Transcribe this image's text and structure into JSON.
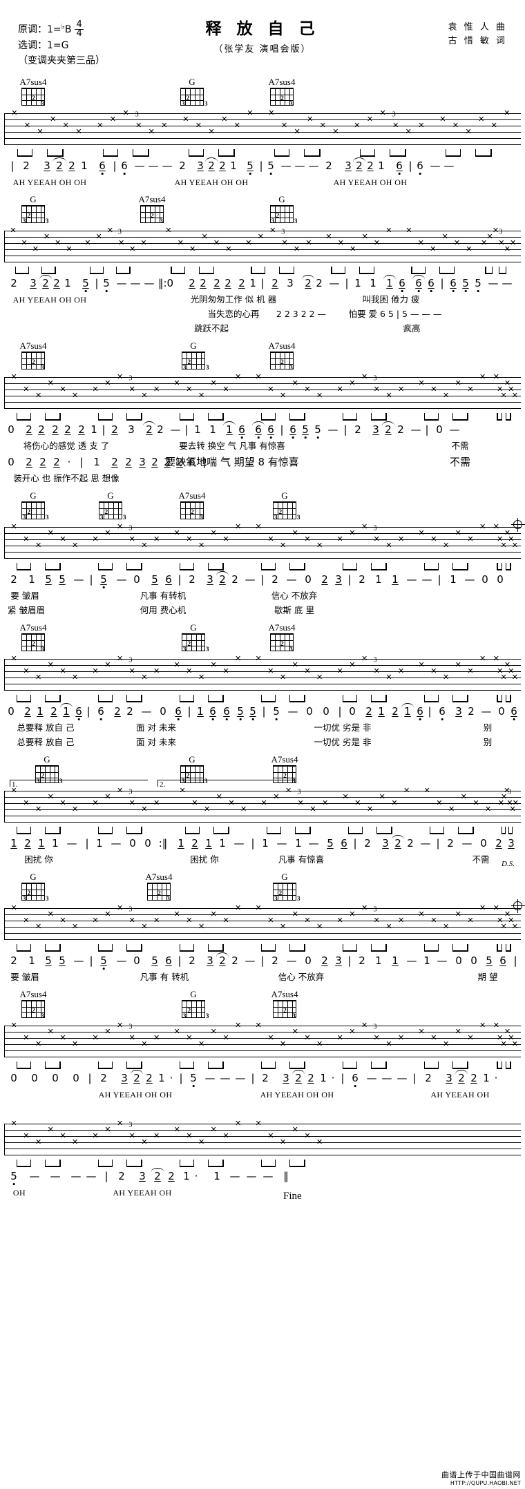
{
  "header": {
    "original_key_label": "原调：",
    "original_key_value": "1=",
    "original_key_note": "B",
    "original_key_accidental": "♭",
    "selected_key_label": "选调：",
    "selected_key_value": "1=G",
    "time_sig_num": "4",
    "time_sig_den": "4",
    "capo": "（变调夹夹第三品）",
    "title": "释 放 自 己",
    "subtitle": "（张学友  演唱会版）",
    "composer": "袁 惟 人 曲",
    "lyricist": "古 惜 敏 词"
  },
  "watermark": {
    "line1": "曲谱上传于中国曲谱网",
    "line2": "HTTP://QUPU.HAOBI.NET"
  },
  "chords": {
    "a7sus4": {
      "name": "A7sus4",
      "dots": [
        {
          "string": 2,
          "fret": 2,
          "label": "2"
        },
        {
          "string": 4,
          "fret": 3,
          "label": "3"
        }
      ]
    },
    "g": {
      "name": "G",
      "dots": [
        {
          "string": 1,
          "fret": 2,
          "label": "2"
        },
        {
          "string": 0,
          "fret": 3,
          "label": "3"
        },
        {
          "string": 5,
          "fret": 3,
          "label": "3"
        }
      ]
    }
  },
  "systems": [
    {
      "id": "system-1",
      "chord_labels": [
        "A7sus4",
        "G",
        "A7sus4"
      ],
      "jianpu": "| 2  3 2 2 1  6 | 6 — — — | 2 3 2 2 1 6 | 5 — — — | 2 3 2 2 1 6 | 6 — —",
      "lyrics": [
        "AH  YEEAH  OH  OH",
        "AH YEEAH OH OH",
        "AH YEEAH  OH  OH"
      ]
    },
    {
      "id": "system-2",
      "chord_labels": [
        "G",
        "A7sus4",
        "G"
      ],
      "jianpu": "2  3 2 2 1  5 | 5 — — — ‖: 0  2 2 2 2 2 1 | 2  3  2 2 — | 1 1 1 6 6 6 | 6 5 5 — —",
      "lyrics_1": "AH YEEAH  OH OH",
      "lyrics_2": "光阴匆匆工作  似 机 器      叫我困 倦力  疲",
      "lyrics_3": "当失恋的心再   怕要 爱",
      "jianpu_row2": "2 2 3 2 2  —   6 5 | 5 — — —",
      "lyrics_row2": "跳跃不起                       疯高"
    },
    {
      "id": "system-3",
      "chord_labels": [
        "A7sus4",
        "G",
        "A7sus4"
      ],
      "jianpu_1": "0  2 2 2 2 2 1 | 2  3  2 2 — | 1 1 1 6 6 6 | 6 5 5 — — | 2 3 2 2 — | 0 —",
      "lyrics_1": "将伤心的感觉  透 支 了      要去转 换空  气 凡事 有惊喜          不需",
      "jianpu_2": "0  2 2 2 · | 1  2 2 3 2 2 2 6 |",
      "lyrics_2": "装开心 也 振作不起  思 想像",
      "lyrics_2b": "要缺氧地喘  气 期望 8 有惊喜          不需"
    },
    {
      "id": "system-4",
      "chord_labels": [
        "G",
        "A7sus4",
        "G"
      ],
      "jianpu": "2 1 5 5 — | 5 — 0  5 6 | 2 3 2 2 — | 2 — 0  2 3 | 2 1 1 — — | 1 — 0 0",
      "lyrics_1": "要 皱眉              凡事 有转机          信心 不放弃",
      "lyrics_2": "紧 皱眉眉           何用 费心机          歇斯 底 里"
    },
    {
      "id": "system-5",
      "chord_labels": [
        "A7sus4",
        "G",
        "A7sus4"
      ],
      "jianpu": "0  2 1 2 1 6 | 6 2 2 — 0 6 | 1 6 6 5 5 | 5 — 0 0 | 0  2 1 2 1 6 | 6 3 2 — 0 6",
      "lyrics_1": "总要释 放自 己      面 对  未来                  一切优 劣是  非        别",
      "lyrics_2": "总要释 放自 己      面 对  未来                  一切优 劣是  非        别"
    },
    {
      "id": "system-6",
      "volta_1": "1.",
      "volta_2": "2.",
      "chord_labels": [
        "G",
        "G",
        "A7sus4"
      ],
      "jianpu": "1 2 1 1 — | 1 — 0 0 :‖ 1 2 1 1 — | 1 — 1 — 5 6 | 2 3 2 2 — | 2 — 0  2 3",
      "lyrics_1": "困扰  你",
      "lyrics_2": "困扰  你      凡事  有惊喜                  不需"
    },
    {
      "id": "system-7",
      "chord_labels": [
        "G",
        "A7sus4",
        "G"
      ],
      "jianpu": "2 1 5 5 — | 5 — 0  5 6 | 2 3 2 2 — | 2 — 0  2 3 | 2 1 1 — 1 — 0 0 5 6 | 6",
      "lyrics": "要 皱眉              凡事 有 转机          信心 不放弃                        期 望",
      "marking": "D.S."
    },
    {
      "id": "system-8",
      "chord_labels": [
        "A7sus4",
        "G",
        "A7sus4"
      ],
      "jianpu": "0 0 0 0 | 2  3 2 2 1 · | 5 — — — | 2  3 2 2 1 · | 6 — — — | 2  3 2 2 1 ·",
      "lyrics": [
        "AH YEEAH OH   OH",
        "AH YEEAH OH      OH",
        "AH YEEAH  OH"
      ]
    },
    {
      "id": "system-9",
      "chord_labels": [],
      "jianpu": "5 — — — | 2  3 2 2 1 · | 1 — — —  ‖",
      "lyrics": "OH              AH  YEEAH   OH",
      "fine": "Fine"
    }
  ]
}
